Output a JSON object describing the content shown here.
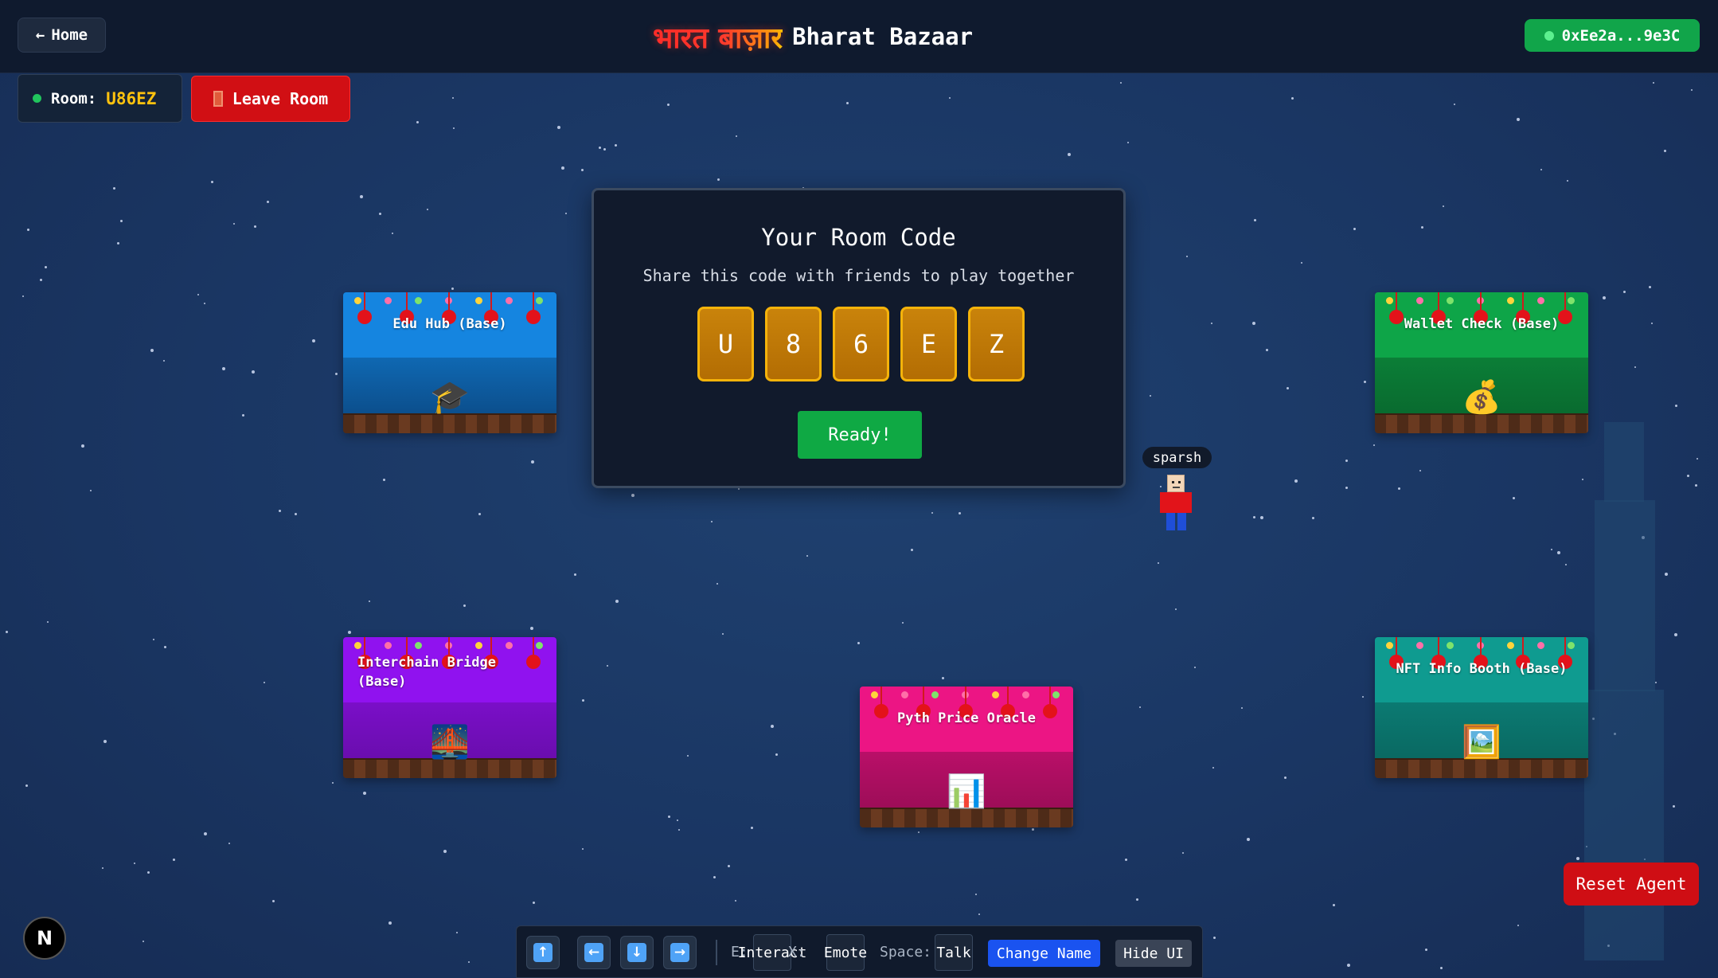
{
  "header": {
    "home_label": "Home",
    "home_icon": "arrow-left-icon",
    "brand_hindi": "भारत बाज़ार",
    "brand_name": "Bharat Bazaar",
    "wallet_address": "0xEe2a...9e3C"
  },
  "room": {
    "label": "Room:",
    "code": "U86EZ",
    "leave_label": "Leave Room"
  },
  "modal": {
    "title": "Your Room Code",
    "subtitle": "Share this code with friends to play together",
    "code_chars": [
      "U",
      "8",
      "6",
      "E",
      "Z"
    ],
    "ready_label": "Ready!"
  },
  "booths": [
    {
      "title": "Edu Hub (Base)",
      "icon": "graduation-cap-icon",
      "color": "#1585e0"
    },
    {
      "title": "Wallet Check (Base)",
      "icon": "money-bag-icon",
      "color": "#0ea548"
    },
    {
      "title": "Interchain Bridge (Base)",
      "icon": "bridge-at-night-icon",
      "color": "#9012ef"
    },
    {
      "title": "Pyth Price Oracle",
      "icon": "bar-chart-icon",
      "color": "#ec1584"
    },
    {
      "title": "NFT Info Booth (Base)",
      "icon": "framed-picture-icon",
      "color": "#0f9b90"
    }
  ],
  "player": {
    "name": "sparsh"
  },
  "reset_label": "Reset Agent",
  "controls": {
    "interact_key": "E:",
    "interact_label": "Interact",
    "emote_key": "X:",
    "emote_label": "Emote",
    "talk_key": "Space:",
    "talk_label": "Talk",
    "change_name_label": "Change Name",
    "hide_ui_label": "Hide UI"
  },
  "next_badge": "N"
}
